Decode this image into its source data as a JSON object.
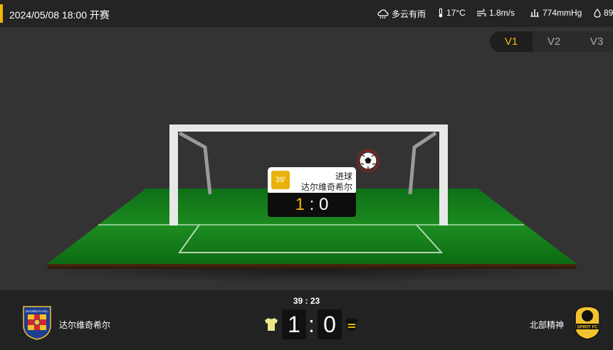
{
  "header": {
    "datetime": "2024/05/08 18:00 开赛",
    "weather": {
      "condition": "多云有雨",
      "temperature": "17°C",
      "wind": "1.8m/s",
      "pressure": "774mmHg",
      "humidity": "89"
    }
  },
  "view_tabs": [
    {
      "label": "V1",
      "active": true
    },
    {
      "label": "V2",
      "active": false
    },
    {
      "label": "V3",
      "active": false
    }
  ],
  "event": {
    "minute": "39'",
    "type": "进球",
    "team": "达尔维奇希尔",
    "score_home": "1",
    "score_sep": ":",
    "score_away": "0"
  },
  "match": {
    "clock": "39 : 23",
    "home": {
      "name": "达尔维奇希尔",
      "score": "1",
      "logo_text": "DULWICH HILL"
    },
    "away": {
      "name": "北部精神",
      "score": "0",
      "logo_text": "SPIRIT FC"
    },
    "score_sep": ":"
  },
  "colors": {
    "accent": "#f2b705",
    "pitch": "#1f8a1f",
    "panel": "#222222"
  }
}
